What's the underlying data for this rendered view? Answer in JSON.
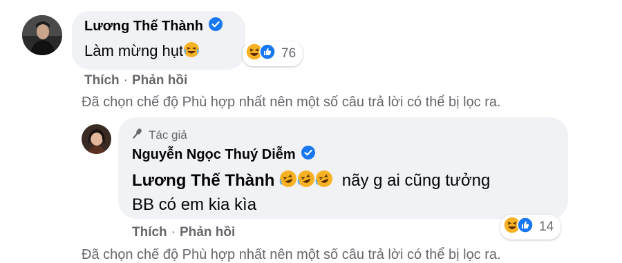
{
  "comment1": {
    "author": "Lương Thế Thành",
    "text": "Làm mừng hụt",
    "reaction_count": "76",
    "actions": {
      "like": "Thích",
      "reply": "Phản hồi"
    },
    "filter_note": "Đã chọn chế độ Phù hợp nhất nên một số câu trả lời có thể bị lọc ra."
  },
  "reply1": {
    "author_tag": "Tác giả",
    "author": "Nguyễn Ngọc Thuý Diễm",
    "mention": "Lương Thế Thành",
    "text_line1": "nãy g ai cũng tưởng",
    "text_line2": "BB có em kia kìa",
    "reaction_count": "14",
    "actions": {
      "like": "Thích",
      "reply": "Phản hồi"
    }
  },
  "bottom_filter_note": "Đã chọn chế độ Phù hợp nhất nên một số câu trả lời có thể bị lọc ra.",
  "colors": {
    "bubble": "#f0f2f5",
    "secondary_text": "#65676b",
    "verified": "#1877f2",
    "like": "#1877f2",
    "haha": "#f7b125"
  },
  "icons": [
    "verified-badge-icon",
    "laughing-emoji-icon",
    "like-reaction-icon",
    "haha-reaction-icon",
    "rolling-laughing-emoji-icon",
    "microphone-icon"
  ]
}
